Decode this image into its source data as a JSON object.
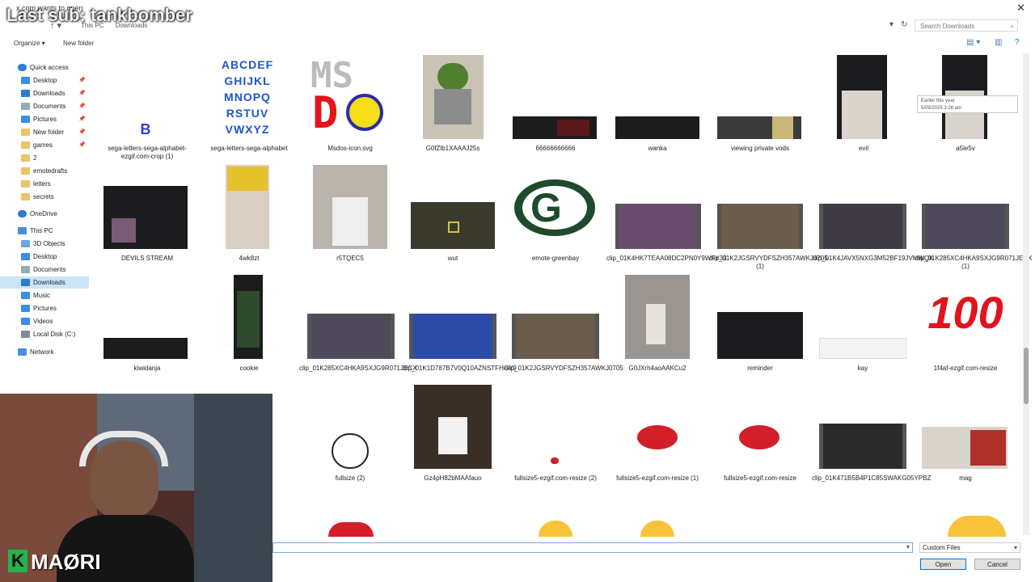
{
  "window": {
    "title": "x.com wants to open"
  },
  "overlay": {
    "subscriber": "Last sub: tankbomber",
    "brand": "MAØRI",
    "brand_letter": "K"
  },
  "address": {
    "crumbs": [
      "This PC",
      "Downloads"
    ],
    "search_placeholder": "Search Downloads"
  },
  "toolbar": {
    "organize": "Organize ▾",
    "new_folder": "New folder"
  },
  "sidebar": {
    "items": [
      {
        "label": "Quick access",
        "icon": "star-icon",
        "color": "#2f7fd6"
      },
      {
        "label": "Desktop",
        "icon": "desktop-icon",
        "color": "#3a8ee6",
        "pinned": true
      },
      {
        "label": "Downloads",
        "icon": "download-icon",
        "color": "#2a7bd4",
        "pinned": true
      },
      {
        "label": "Documents",
        "icon": "document-icon",
        "color": "#9aa8b8",
        "pinned": true
      },
      {
        "label": "Pictures",
        "icon": "pictures-icon",
        "color": "#3a8ee6",
        "pinned": true
      },
      {
        "label": "New folder",
        "icon": "folder-icon",
        "color": "#e9c46a",
        "pinned": true
      },
      {
        "label": "games",
        "icon": "folder-icon",
        "color": "#e9c46a",
        "pinned": true
      },
      {
        "label": "2",
        "icon": "folder-icon",
        "color": "#e9c46a"
      },
      {
        "label": "emotedrafts",
        "icon": "folder-icon",
        "color": "#e9c46a"
      },
      {
        "label": "letters",
        "icon": "folder-icon",
        "color": "#e9c46a"
      },
      {
        "label": "secrets",
        "icon": "folder-icon",
        "color": "#e9c46a"
      },
      {
        "label": "OneDrive",
        "icon": "cloud-icon",
        "color": "#2a7bd4"
      },
      {
        "label": "This PC",
        "icon": "computer-icon",
        "color": "#4a90d9"
      },
      {
        "label": "3D Objects",
        "icon": "cube-icon",
        "color": "#6aa7e0"
      },
      {
        "label": "Desktop",
        "icon": "desktop-icon",
        "color": "#3a8ee6"
      },
      {
        "label": "Documents",
        "icon": "document-icon",
        "color": "#9aa8b8"
      },
      {
        "label": "Downloads",
        "icon": "download-icon",
        "color": "#2a7bd4",
        "selected": true
      },
      {
        "label": "Music",
        "icon": "music-icon",
        "color": "#3a8ee6"
      },
      {
        "label": "Pictures",
        "icon": "pictures-icon",
        "color": "#3a8ee6"
      },
      {
        "label": "Videos",
        "icon": "video-icon",
        "color": "#3a8ee6"
      },
      {
        "label": "Local Disk (C:)",
        "icon": "drive-icon",
        "color": "#7f8c99"
      },
      {
        "label": "Network",
        "icon": "network-icon",
        "color": "#4a90d9"
      }
    ]
  },
  "files": [
    {
      "name": "sega-letters-sega-alphabet-ezgif.com-crop (1)",
      "kind": "letter-b"
    },
    {
      "name": "sega-letters-sega-alphabet",
      "kind": "alphabet"
    },
    {
      "name": "Msdos-icon.svg",
      "kind": "msdos"
    },
    {
      "name": "G0fZlb1XAAAJ25s",
      "kind": "photo"
    },
    {
      "name": "66666666666",
      "kind": "screenshot"
    },
    {
      "name": "wanka",
      "kind": "screenshot"
    },
    {
      "name": "viewing private vods",
      "kind": "screenshot"
    },
    {
      "name": "evil",
      "kind": "photo"
    },
    {
      "name": "a5le5v",
      "kind": "photo"
    },
    {
      "name": "DEVILS STREAM",
      "kind": "screenshot"
    },
    {
      "name": "4wk8zt",
      "kind": "photo"
    },
    {
      "name": "r5TQEC5",
      "kind": "photo"
    },
    {
      "name": "wut",
      "kind": "screenshot"
    },
    {
      "name": "emote-greenbay",
      "kind": "logo"
    },
    {
      "name": "clip_01K4HK7TEAA08DC2PN0Y9WFY33",
      "kind": "video"
    },
    {
      "name": "clip_01K2JGSRVYDFSZH357AWKJ0705 (1)",
      "kind": "video"
    },
    {
      "name": "clip_01K4JAVX5NXG3M52BF19JVMWQK",
      "kind": "video"
    },
    {
      "name": "clip_01K285XC4HKA9SXJG9R071JECX (1)",
      "kind": "video"
    },
    {
      "name": "kiwidanja",
      "kind": "screenshot"
    },
    {
      "name": "cookie",
      "kind": "screenshot"
    },
    {
      "name": "clip_01K285XC4HKA9SXJG9R071JECX",
      "kind": "video"
    },
    {
      "name": "clip_01K1D787B7V0Q10AZNSTFHGY9",
      "kind": "video"
    },
    {
      "name": "clip_01K2JGSRVYDFSZH357AWKJ0705",
      "kind": "video"
    },
    {
      "name": "G0JXrh4aoAAKCu2",
      "kind": "photo"
    },
    {
      "name": "reminder",
      "kind": "screenshot"
    },
    {
      "name": "kay",
      "kind": "screenshot"
    },
    {
      "name": "1f4af-ezgif.com-resize",
      "kind": "emoji-100"
    },
    {
      "name": "fullsize (2)",
      "kind": "skull"
    },
    {
      "name": "Gz4pH82bMAAfauo",
      "kind": "photo"
    },
    {
      "name": "fullsize5-ezgif.com-resize (2)",
      "kind": "lips-small"
    },
    {
      "name": "fullsize5-ezgif.com-resize (1)",
      "kind": "lips"
    },
    {
      "name": "fullsize5-ezgif.com-resize",
      "kind": "lips"
    },
    {
      "name": "clip_01K471B5B4P1C85SWAKG05YPBZ",
      "kind": "video"
    },
    {
      "name": "mag",
      "kind": "comic"
    }
  ],
  "tooltip": {
    "line1": "Earlier this year",
    "line2": "5/09/2025 3:26 am"
  },
  "bottom": {
    "file_type": "Custom Files",
    "open": "Open",
    "cancel": "Cancel"
  }
}
